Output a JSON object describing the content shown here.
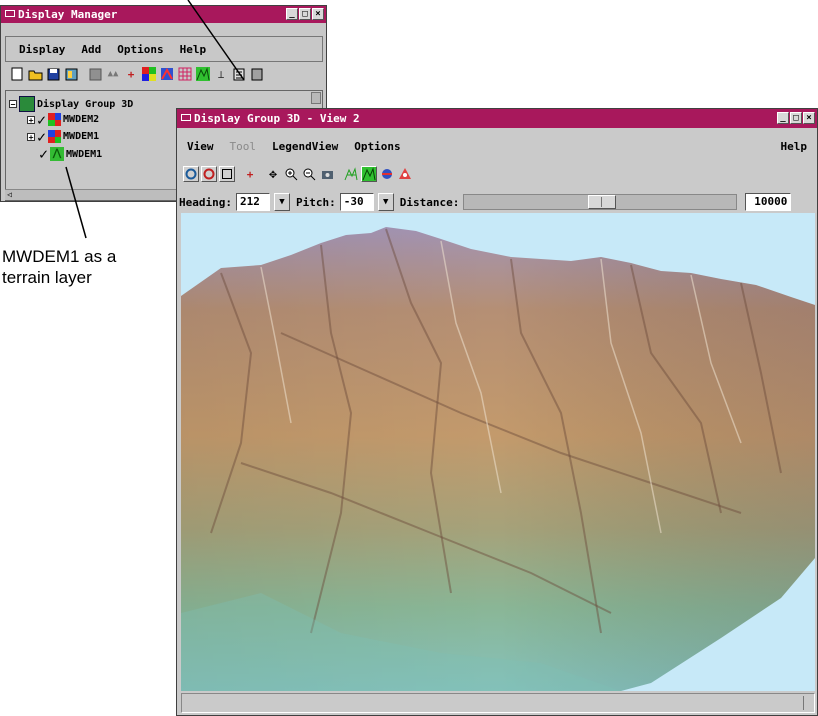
{
  "dm": {
    "title": "Display Manager",
    "menus": [
      "Display",
      "Add",
      "Options",
      "Help"
    ],
    "tree": {
      "group": "Display Group 3D",
      "layers": [
        "MWDEM2",
        "MWDEM1",
        "MWDEM1"
      ]
    }
  },
  "view": {
    "title": "Display Group 3D - View 2",
    "menus": [
      "View",
      "Tool",
      "LegendView",
      "Options"
    ],
    "help": "Help",
    "heading_label": "Heading:",
    "heading_value": "212",
    "pitch_label": "Pitch:",
    "pitch_value": "-30",
    "distance_label": "Distance:",
    "distance_value": "10000"
  },
  "annotation": {
    "line1": "MWDEM1 as a",
    "line2": "terrain layer"
  },
  "colors": {
    "titlebar": "#a8185c",
    "window_bg": "#c8c8c8",
    "sky": "#c7e9f8"
  }
}
